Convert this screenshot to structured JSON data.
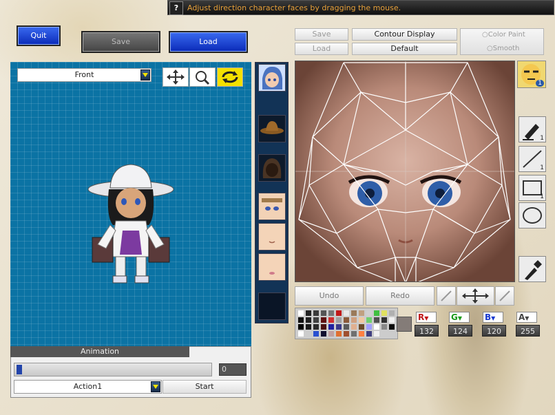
{
  "hint": {
    "text": "Adjust direction character faces by dragging the mouse."
  },
  "top_buttons": {
    "quit": "Quit",
    "save": "Save",
    "load": "Load"
  },
  "view": {
    "direction": "Front"
  },
  "animation": {
    "title": "Animation",
    "frame": "0",
    "action": "Action1",
    "start": "Start",
    "progress": 0.01
  },
  "editor": {
    "save": "Save",
    "load": "Load",
    "contour_display": "Contour Display",
    "default": "Default",
    "color_paint": "Color Paint",
    "smooth": "Smooth",
    "undo": "Undo",
    "redo": "Redo"
  },
  "tool_counts": {
    "face": "1",
    "pen": "1",
    "line": "1",
    "rect": "1"
  },
  "color": {
    "r_label": "R",
    "g_label": "G",
    "b_label": "B",
    "a_label": "A",
    "r": "132",
    "g": "124",
    "b": "120",
    "a": "255"
  },
  "colors": {
    "accent_blue": "#1a3fd6",
    "viewport": "#0b73a4",
    "hint_text": "#e8a13a"
  }
}
